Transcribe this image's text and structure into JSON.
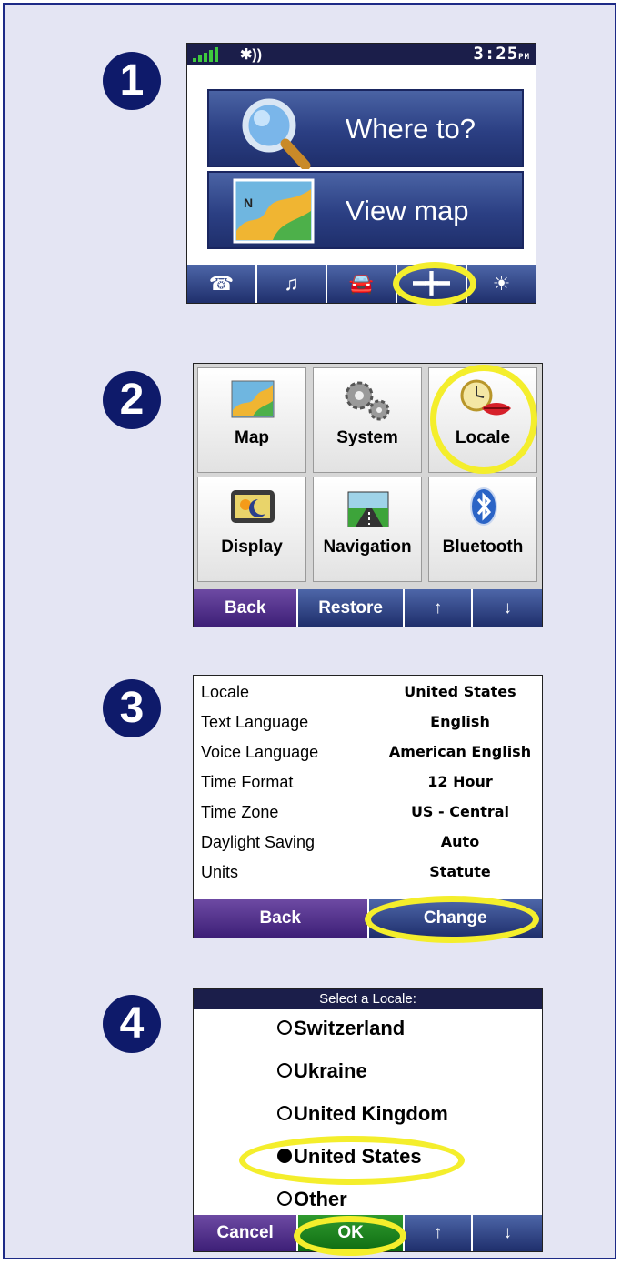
{
  "steps": [
    "1",
    "2",
    "3",
    "4"
  ],
  "screen1": {
    "status": {
      "bluetooth_icon": "bluetooth-icon",
      "clock": "3:25",
      "clock_suffix": "PM"
    },
    "where_to_label": "Where to?",
    "view_map_label": "View map",
    "toolbar_icons": [
      "phone-icon",
      "music-icon",
      "traffic-icon",
      "wrench-icon",
      "brightness-icon"
    ]
  },
  "screen2": {
    "tiles": [
      {
        "label": "Map",
        "icon": "map-icon"
      },
      {
        "label": "System",
        "icon": "gears-icon"
      },
      {
        "label": "Locale",
        "icon": "clock-lips-icon"
      },
      {
        "label": "Display",
        "icon": "display-icon"
      },
      {
        "label": "Navigation",
        "icon": "road-icon"
      },
      {
        "label": "Bluetooth",
        "icon": "bluetooth-icon"
      }
    ],
    "bar": {
      "back": "Back",
      "restore": "Restore",
      "up": "↑",
      "down": "↓"
    }
  },
  "screen3": {
    "rows": [
      {
        "key": "Locale",
        "value": "United States"
      },
      {
        "key": "Text Language",
        "value": "English"
      },
      {
        "key": "Voice Language",
        "value": "American English"
      },
      {
        "key": "Time Format",
        "value": "12 Hour"
      },
      {
        "key": "Time Zone",
        "value": "US - Central"
      },
      {
        "key": "Daylight Saving",
        "value": "Auto"
      },
      {
        "key": "Units",
        "value": "Statute"
      }
    ],
    "bar": {
      "back": "Back",
      "change": "Change"
    }
  },
  "screen4": {
    "title": "Select a Locale:",
    "options": [
      {
        "label": "Switzerland",
        "selected": false
      },
      {
        "label": "Ukraine",
        "selected": false
      },
      {
        "label": "United Kingdom",
        "selected": false
      },
      {
        "label": "United States",
        "selected": true
      },
      {
        "label": "Other",
        "selected": false
      }
    ],
    "bar": {
      "cancel": "Cancel",
      "ok": "OK",
      "up": "↑",
      "down": "↓"
    }
  },
  "colors": {
    "highlight": "#f4ee2c",
    "step_badge": "#0e1a6a",
    "panel_bg": "#e4e5f3"
  }
}
